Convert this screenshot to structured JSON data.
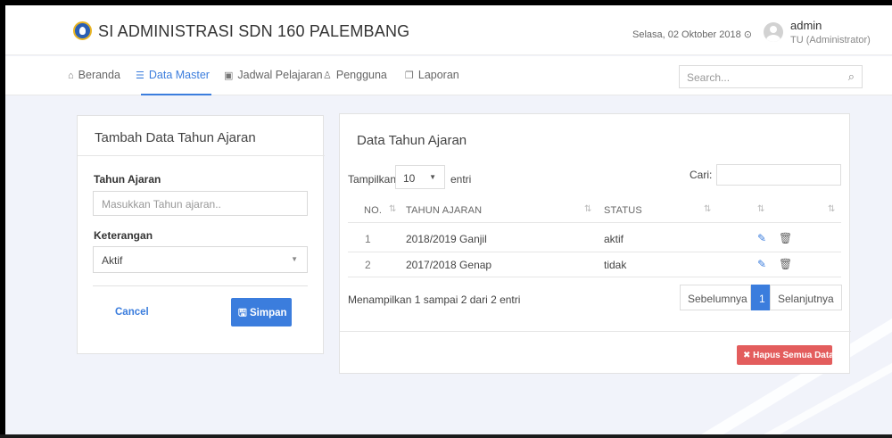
{
  "header": {
    "app_title": "SI ADMINISTRASI SDN 160 PALEMBANG",
    "date": "Selasa, 02 Oktober 2018",
    "user_name": "admin",
    "user_role": "TU (Administrator)"
  },
  "nav": {
    "items": [
      {
        "label": "Beranda",
        "icon": "home-icon",
        "active": false
      },
      {
        "label": "Data Master",
        "icon": "database-icon",
        "active": true
      },
      {
        "label": "Jadwal Pelajaran",
        "icon": "calendar-icon",
        "active": false
      },
      {
        "label": "Pengguna",
        "icon": "users-icon",
        "active": false
      },
      {
        "label": "Laporan",
        "icon": "copy-icon",
        "active": false
      }
    ],
    "search_placeholder": "Search..."
  },
  "form": {
    "title": "Tambah Data Tahun Ajaran",
    "tahun_label": "Tahun Ajaran",
    "tahun_placeholder": "Masukkan Tahun ajaran..",
    "keterangan_label": "Keterangan",
    "keterangan_value": "Aktif",
    "cancel_label": "Cancel",
    "save_label": "Simpan"
  },
  "table": {
    "title": "Data Tahun Ajaran",
    "show_label": "Tampilkan",
    "page_length": "10",
    "entries_label": "entri",
    "search_label": "Cari:",
    "columns": [
      "NO.",
      "TAHUN AJARAN",
      "STATUS"
    ],
    "rows": [
      {
        "no": "1",
        "tahun": "2018/2019 Ganjil",
        "status": "aktif"
      },
      {
        "no": "2",
        "tahun": "2017/2018 Genap",
        "status": "tidak"
      }
    ],
    "info": "Menampilkan 1 sampai 2 dari 2 entri",
    "prev_label": "Sebelumnya",
    "current_page": "1",
    "next_label": "Selanjutnya",
    "delete_all_label": "Hapus Semua Data"
  },
  "colors": {
    "primary": "#3b7ddd",
    "danger": "#e35d5d",
    "background": "#f1f3fa"
  }
}
